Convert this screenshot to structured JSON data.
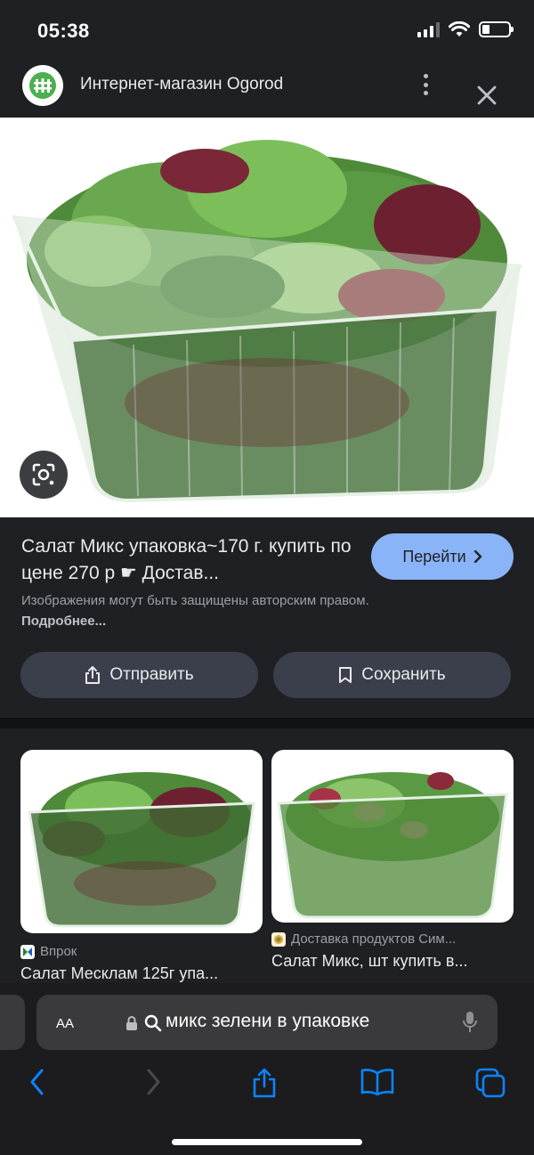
{
  "status_bar": {
    "time": "05:38"
  },
  "header": {
    "site_name": "Интернет-магазин Ogorod"
  },
  "main_result": {
    "title": "Салат Микс упаковка~170 г. купить по цене 270 р ☛ Достав...",
    "visit_label": "Перейти",
    "copyright_text": "Изображения могут быть защищены авторским правом.",
    "more_label": "Подробнее...",
    "share_label": "Отправить",
    "save_label": "Сохранить"
  },
  "related": [
    {
      "source": "Впрок",
      "title": "Салат Месклам 125г упа..."
    },
    {
      "source": "Доставка продуктов Сим...",
      "title": "Салат Микс, шт купить в..."
    }
  ],
  "address_bar": {
    "aa_label": "AA",
    "query": "микс зелени в упаковке"
  },
  "colors": {
    "accent": "#8ab4f8",
    "background": "#1f2023",
    "toolbar": "#1c1c1e",
    "safari_blue": "#0a84ff"
  }
}
